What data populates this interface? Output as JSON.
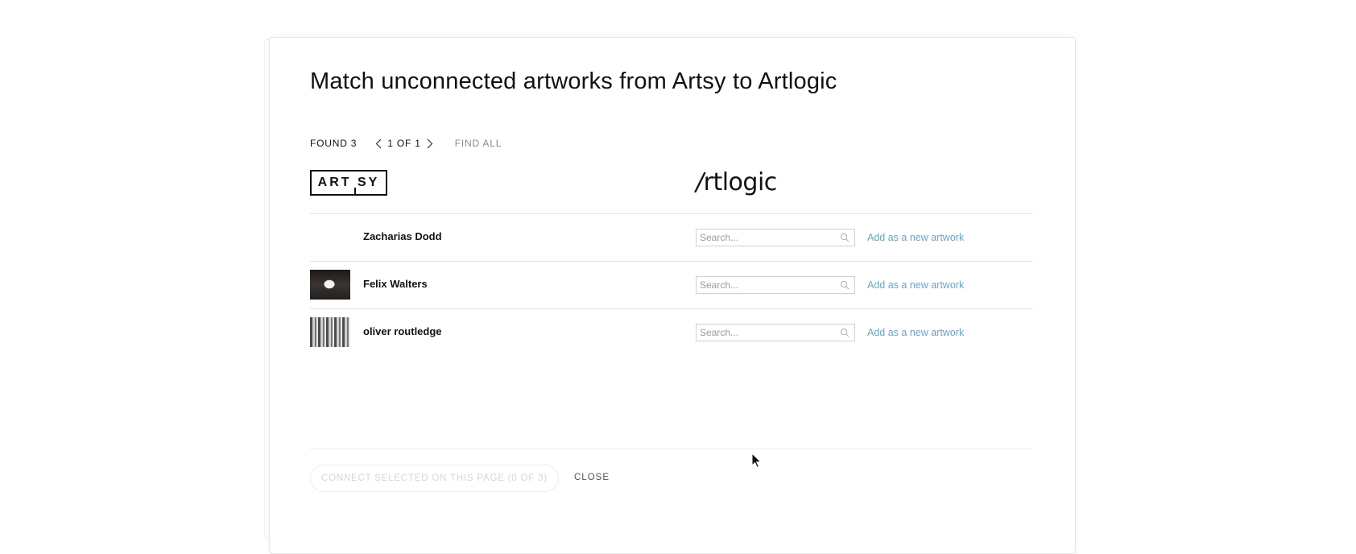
{
  "dialog": {
    "title": "Match unconnected artworks from Artsy to Artlogic"
  },
  "pager": {
    "found": "FOUND 3",
    "page": "1 OF 1",
    "find_all": "FIND ALL"
  },
  "logos": {
    "artsy": "ART SY",
    "artlogic_slash": "/",
    "artlogic_text": "rtlogic"
  },
  "rows": [
    {
      "artist": "Zacharias Dodd",
      "thumbnail": "none",
      "search_placeholder": "Search...",
      "add_link": "Add as a new artwork"
    },
    {
      "artist": "Felix Walters",
      "thumbnail": "dark-photo",
      "search_placeholder": "Search...",
      "add_link": "Add as a new artwork"
    },
    {
      "artist": "oliver routledge",
      "thumbnail": "striped-pattern",
      "search_placeholder": "Search...",
      "add_link": "Add as a new artwork"
    }
  ],
  "footer": {
    "connect_label": "CONNECT SELECTED ON THIS PAGE (0 OF 3)",
    "close_label": "CLOSE"
  },
  "colors": {
    "link": "#6ca3c2",
    "disabled_text": "#d6d6d6",
    "divider": "#e3e3e3"
  }
}
